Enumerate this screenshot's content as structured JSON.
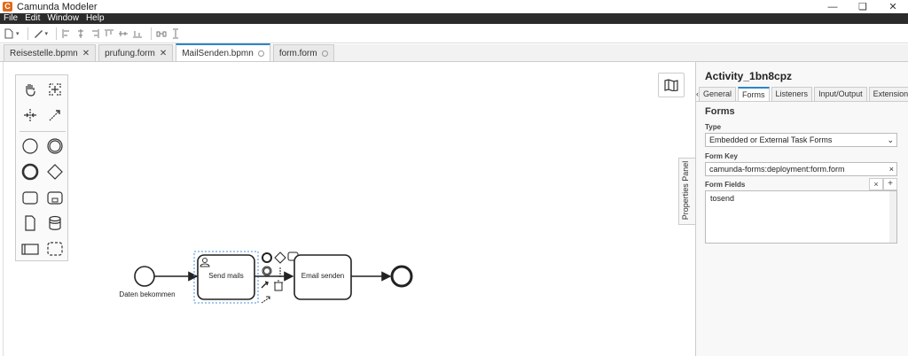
{
  "window": {
    "title": "Camunda Modeler",
    "app_icon_letter": "C"
  },
  "menu": [
    "File",
    "Edit",
    "Window",
    "Help"
  ],
  "tabs": [
    {
      "label": "Reisestelle.bpmn",
      "state": "close"
    },
    {
      "label": "prufung.form",
      "state": "close"
    },
    {
      "label": "MailSenden.bpmn",
      "state": "dot",
      "active": true
    },
    {
      "label": "form.form",
      "state": "dot"
    }
  ],
  "diagram": {
    "start_event_label": "Daten bekommen",
    "task1_label": "Send mails",
    "task2_label": "Email senden"
  },
  "properties_panel": {
    "toggle_label": "Properties Panel",
    "element_id": "Activity_1bn8cpz",
    "tabs": [
      "General",
      "Forms",
      "Listeners",
      "Input/Output",
      "Extensions"
    ],
    "active_tab": "Forms",
    "section": "Forms",
    "type_label": "Type",
    "type_value": "Embedded or External Task Forms",
    "form_key_label": "Form Key",
    "form_key_value": "camunda-forms:deployment:form.form",
    "form_fields_label": "Form Fields",
    "form_fields": [
      "tosend"
    ]
  },
  "colors": {
    "accent": "#2b86c5",
    "menubar": "#2b2b2b",
    "selection": "#4a90d9"
  }
}
